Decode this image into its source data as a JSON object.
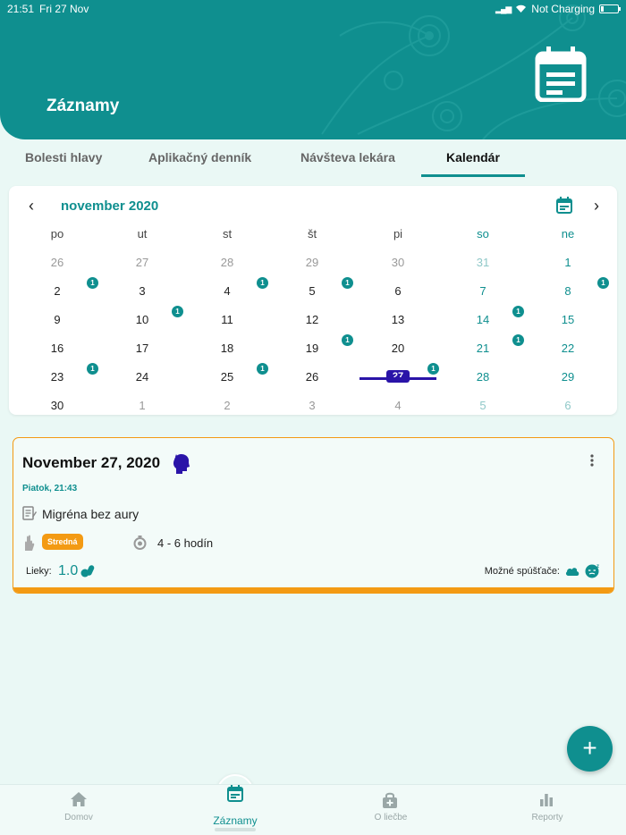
{
  "status": {
    "time": "21:51",
    "date": "Fri 27 Nov",
    "charging": "Not Charging"
  },
  "header": {
    "title": "Záznamy",
    "icon": "calendar-note-icon",
    "color": "#0f8f8f"
  },
  "tabs": [
    {
      "label": "Bolesti hlavy",
      "active": false
    },
    {
      "label": "Aplikačný denník",
      "active": false
    },
    {
      "label": "Návšteva lekára",
      "active": false
    },
    {
      "label": "Kalendár",
      "active": true
    }
  ],
  "calendar": {
    "month_label": "november 2020",
    "weekdays": [
      "po",
      "ut",
      "st",
      "št",
      "pi",
      "so",
      "ne"
    ],
    "today": "27",
    "weeks": [
      [
        {
          "d": "26",
          "muted": true
        },
        {
          "d": "27",
          "muted": true
        },
        {
          "d": "28",
          "muted": true
        },
        {
          "d": "29",
          "muted": true
        },
        {
          "d": "30",
          "muted": true
        },
        {
          "d": "31",
          "muted": true
        },
        {
          "d": "1",
          "muted": false
        }
      ],
      [
        {
          "d": "2",
          "badge": "1"
        },
        {
          "d": "3"
        },
        {
          "d": "4",
          "badge": "1"
        },
        {
          "d": "5",
          "badge": "1"
        },
        {
          "d": "6"
        },
        {
          "d": "7"
        },
        {
          "d": "8",
          "badge": "1"
        }
      ],
      [
        {
          "d": "9"
        },
        {
          "d": "10",
          "badge": "1"
        },
        {
          "d": "11"
        },
        {
          "d": "12"
        },
        {
          "d": "13"
        },
        {
          "d": "14",
          "badge": "1"
        },
        {
          "d": "15"
        }
      ],
      [
        {
          "d": "16"
        },
        {
          "d": "17"
        },
        {
          "d": "18"
        },
        {
          "d": "19",
          "badge": "1"
        },
        {
          "d": "20"
        },
        {
          "d": "21",
          "badge": "1"
        },
        {
          "d": "22"
        }
      ],
      [
        {
          "d": "23",
          "badge": "1"
        },
        {
          "d": "24"
        },
        {
          "d": "25",
          "badge": "1"
        },
        {
          "d": "26"
        },
        {
          "d": "27",
          "badge": "1",
          "today": true
        },
        {
          "d": "28"
        },
        {
          "d": "29"
        }
      ],
      [
        {
          "d": "30"
        },
        {
          "d": "1",
          "muted": true
        },
        {
          "d": "2",
          "muted": true
        },
        {
          "d": "3",
          "muted": true
        },
        {
          "d": "4",
          "muted": true
        },
        {
          "d": "5",
          "muted": true
        },
        {
          "d": "6",
          "muted": true
        }
      ]
    ]
  },
  "entry": {
    "date": "November 27, 2020",
    "subtitle": "Piatok, 21:43",
    "diagnosis": "Migréna bez aury",
    "severity": "Stredná",
    "severity_color": "#f39a13",
    "duration": "4 - 6 hodín",
    "meds_label": "Lieky:",
    "meds_value": "1.0",
    "triggers_label": "Možné spúšťače:"
  },
  "fab": {
    "label": "+"
  },
  "nav": [
    {
      "label": "Domov",
      "icon": "home-icon",
      "active": false
    },
    {
      "label": "Záznamy",
      "icon": "calendar-note-icon",
      "active": true
    },
    {
      "label": "O liečbe",
      "icon": "medkit-icon",
      "active": false
    },
    {
      "label": "Reporty",
      "icon": "bar-chart-icon",
      "active": false
    }
  ]
}
